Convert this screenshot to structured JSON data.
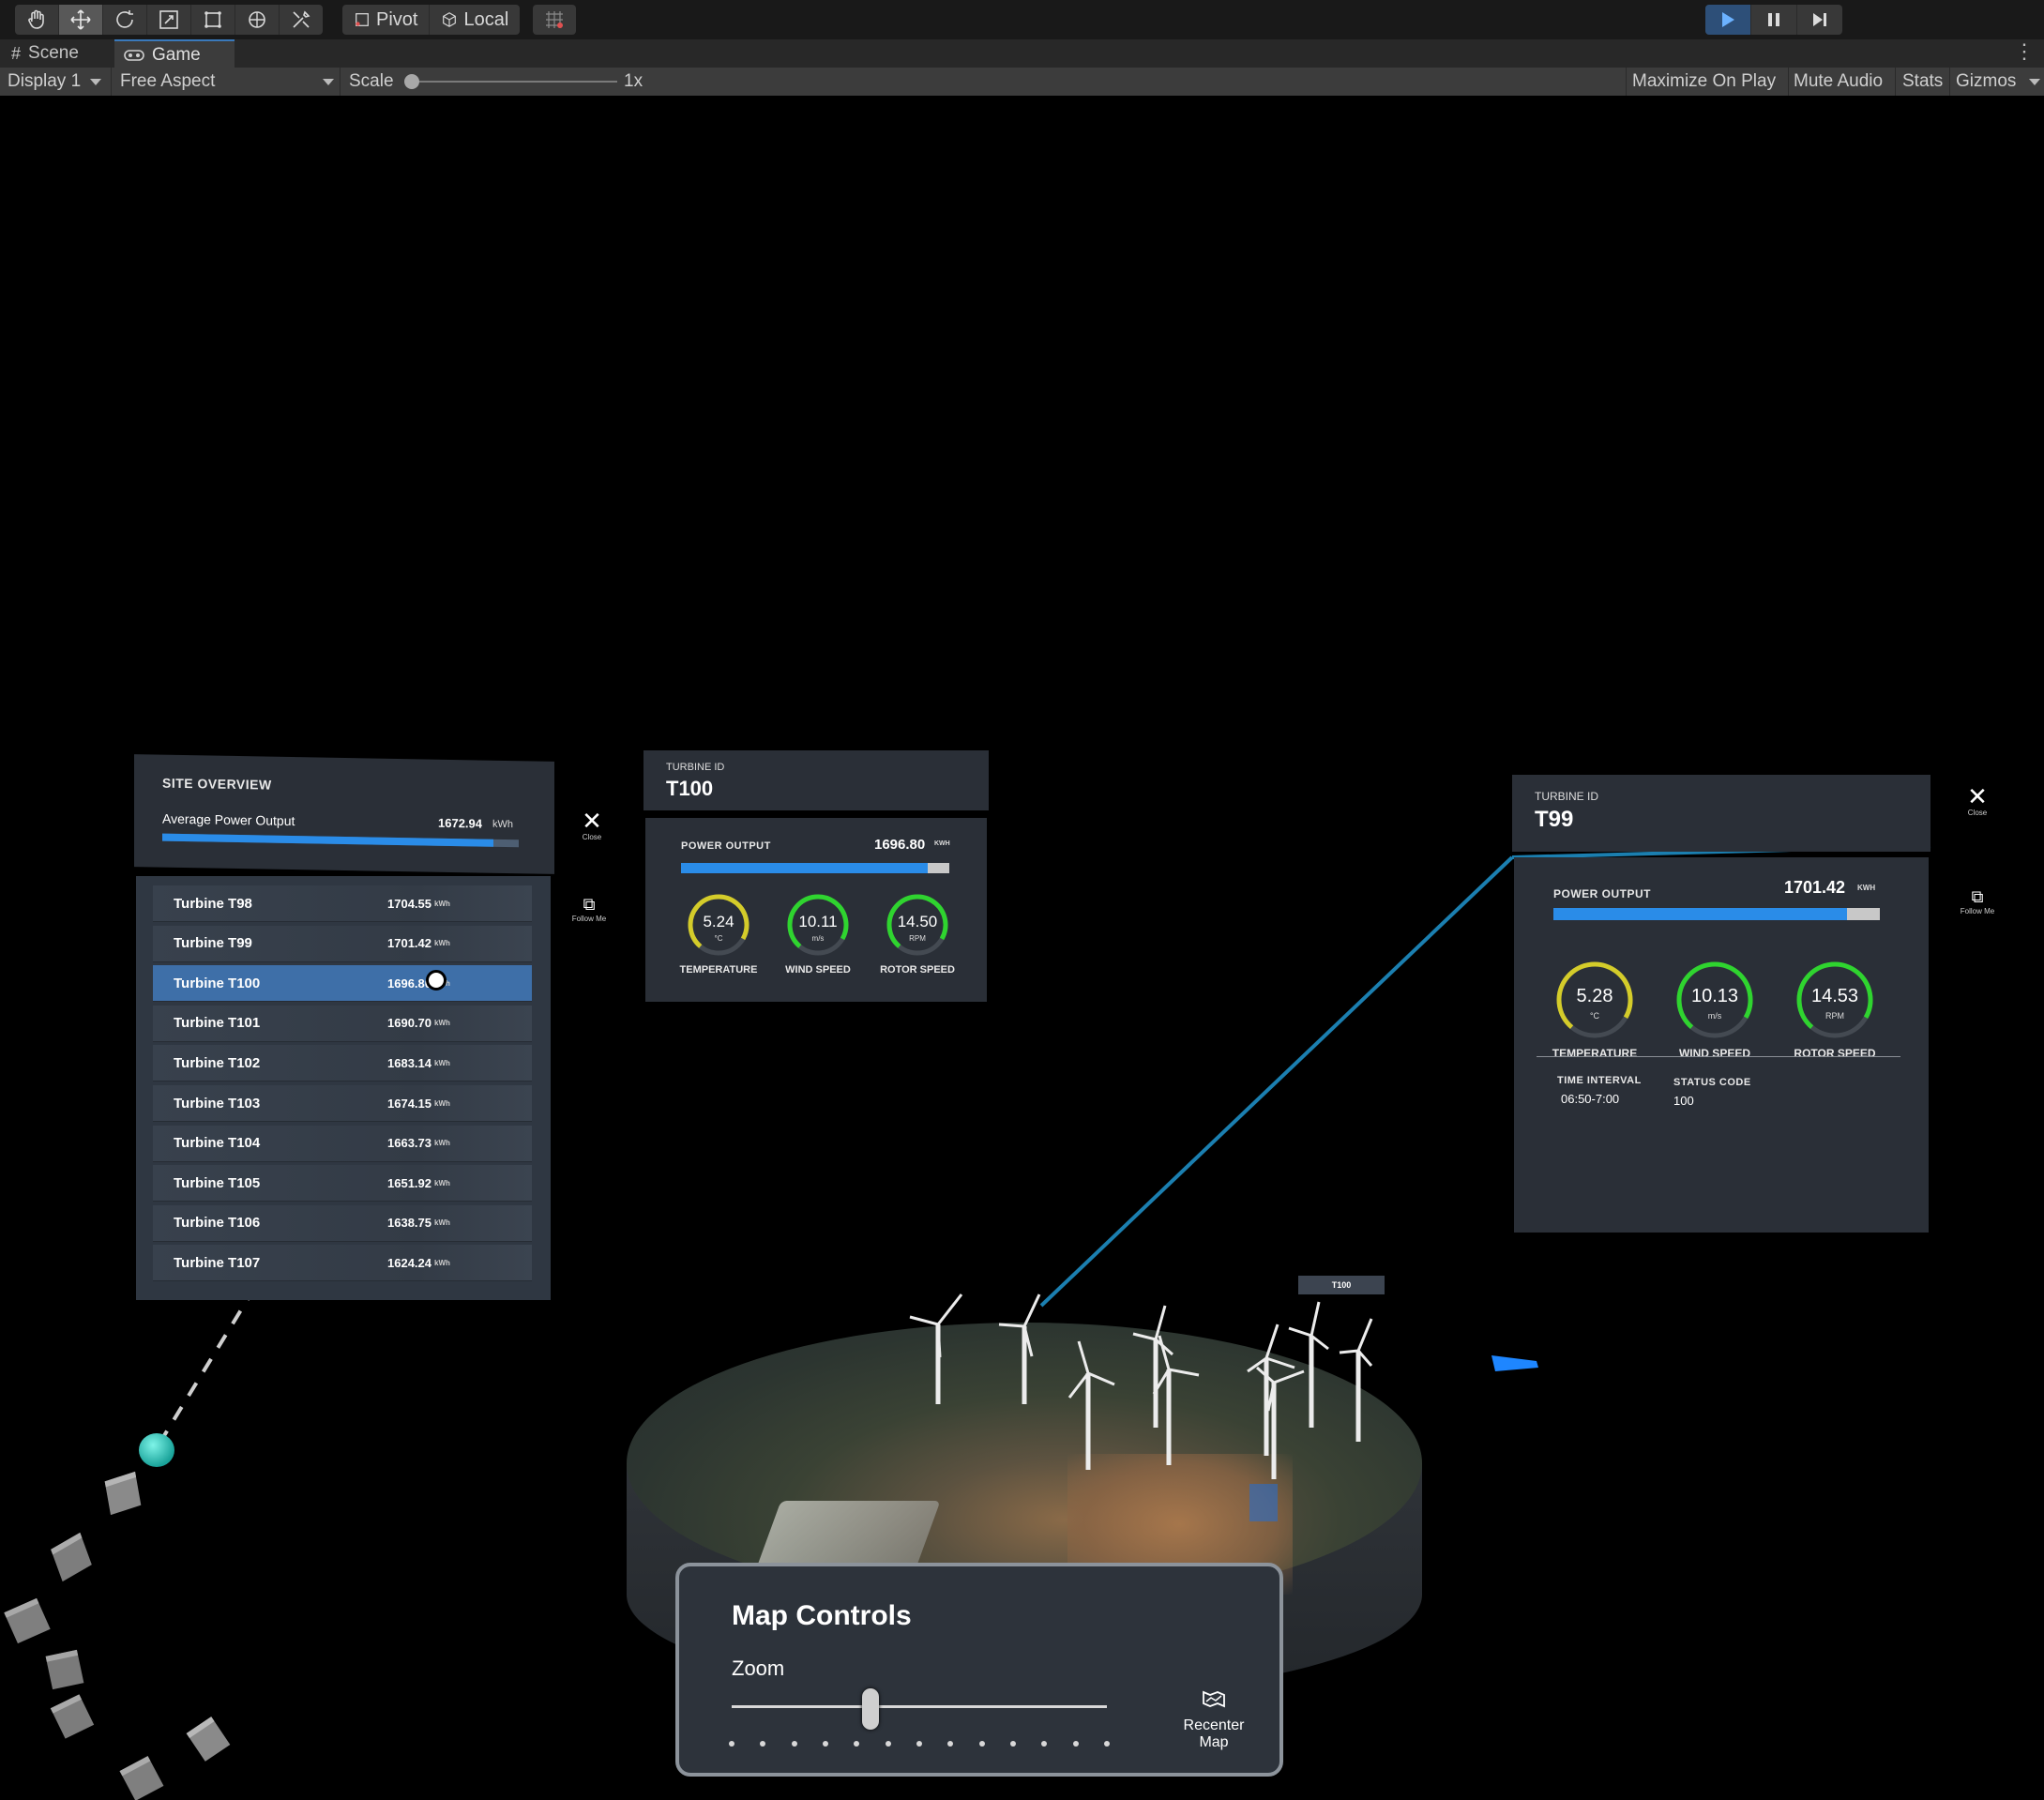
{
  "toolbar": {
    "tools": [
      "hand-tool",
      "move-tool",
      "rotate-tool",
      "scale-tool",
      "rect-tool",
      "transform-tool",
      "custom-tool"
    ],
    "pivot_label": "Pivot",
    "local_label": "Local",
    "grid_snap": "grid-snap-icon"
  },
  "play_controls": [
    "play",
    "pause",
    "step"
  ],
  "tabs": [
    {
      "label": "Scene",
      "icon": "grid-icon"
    },
    {
      "label": "Game",
      "icon": "gamepad-icon"
    }
  ],
  "gamebar": {
    "display": "Display 1",
    "aspect": "Free Aspect",
    "scale_label": "Scale",
    "scale_value": "1x",
    "maximize": "Maximize On Play",
    "mute": "Mute Audio",
    "stats": "Stats",
    "gizmos": "Gizmos"
  },
  "site_overview": {
    "title": "SITE OVERVIEW",
    "avg_label": "Average Power Output",
    "avg_value": "1672.94",
    "avg_unit": "kWh",
    "avg_fill": 0.93,
    "turbines": [
      {
        "name": "Turbine T98",
        "value": "1704.55",
        "unit": "kWh"
      },
      {
        "name": "Turbine T99",
        "value": "1701.42",
        "unit": "kWh"
      },
      {
        "name": "Turbine T100",
        "value": "1696.80",
        "unit": "kWh"
      },
      {
        "name": "Turbine T101",
        "value": "1690.70",
        "unit": "kWh"
      },
      {
        "name": "Turbine T102",
        "value": "1683.14",
        "unit": "kWh"
      },
      {
        "name": "Turbine T103",
        "value": "1674.15",
        "unit": "kWh"
      },
      {
        "name": "Turbine T104",
        "value": "1663.73",
        "unit": "kWh"
      },
      {
        "name": "Turbine T105",
        "value": "1651.92",
        "unit": "kWh"
      },
      {
        "name": "Turbine T106",
        "value": "1638.75",
        "unit": "kWh"
      },
      {
        "name": "Turbine T107",
        "value": "1624.24",
        "unit": "kWh"
      }
    ],
    "close_label": "Close",
    "follow_label": "Follow Me"
  },
  "t100": {
    "id_label": "TURBINE ID",
    "id": "T100",
    "power_label": "POWER OUTPUT",
    "power_value": "1696.80",
    "power_unit": "KWH",
    "power_fill": 0.92,
    "gauges": [
      {
        "value": "5.24",
        "unit": "°C",
        "label": "TEMPERATURE",
        "color": "#d4cc2a"
      },
      {
        "value": "10.11",
        "unit": "m/s",
        "label": "WIND SPEED",
        "color": "#2fd42f"
      },
      {
        "value": "14.50",
        "unit": "RPM",
        "label": "ROTOR SPEED",
        "color": "#2fd42f"
      }
    ]
  },
  "t99": {
    "id_label": "TURBINE ID",
    "id": "T99",
    "power_label": "POWER OUTPUT",
    "power_value": "1701.42",
    "power_unit": "KWH",
    "power_fill": 0.9,
    "gauges": [
      {
        "value": "5.28",
        "unit": "°C",
        "label": "TEMPERATURE",
        "color": "#d4cc2a"
      },
      {
        "value": "10.13",
        "unit": "m/s",
        "label": "WIND SPEED",
        "color": "#2fd42f"
      },
      {
        "value": "14.53",
        "unit": "RPM",
        "label": "ROTOR SPEED",
        "color": "#2fd42f"
      }
    ],
    "interval_label": "TIME INTERVAL",
    "interval_value": "06:50-7:00",
    "status_label": "STATUS CODE",
    "status_value": "100",
    "close_label": "Close",
    "follow_label": "Follow Me"
  },
  "map_label": "T100",
  "map_controls": {
    "title": "Map Controls",
    "zoom_label": "Zoom",
    "zoom_fraction": 0.37,
    "recenter_label": "Recenter Map"
  },
  "colors": {
    "accent": "#2a8ce8",
    "panel": "#2a2f37",
    "connector": "#1b7fb0"
  }
}
